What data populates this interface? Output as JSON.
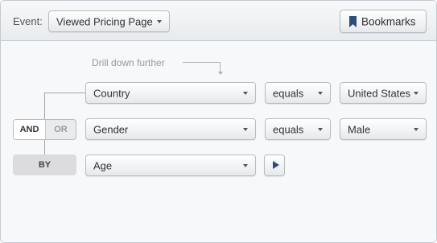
{
  "header": {
    "event_label": "Event:",
    "event_select": {
      "value": "Viewed Pricing Page"
    },
    "bookmarks_button": {
      "label": "Bookmarks",
      "icon": "bookmark-icon"
    }
  },
  "drilldown_hint": "Drill down further",
  "filters": [
    {
      "property": "Country",
      "operator": "equals",
      "value": "United States"
    },
    {
      "property": "Gender",
      "operator": "equals",
      "value": "Male"
    }
  ],
  "connector": {
    "and_label": "AND",
    "or_label": "OR",
    "selected": "AND"
  },
  "breakdown": {
    "label": "BY",
    "property": "Age"
  },
  "colors": {
    "accent": "#2d4d7a",
    "border": "#b7bcc2",
    "background": "#f7f8fa"
  }
}
